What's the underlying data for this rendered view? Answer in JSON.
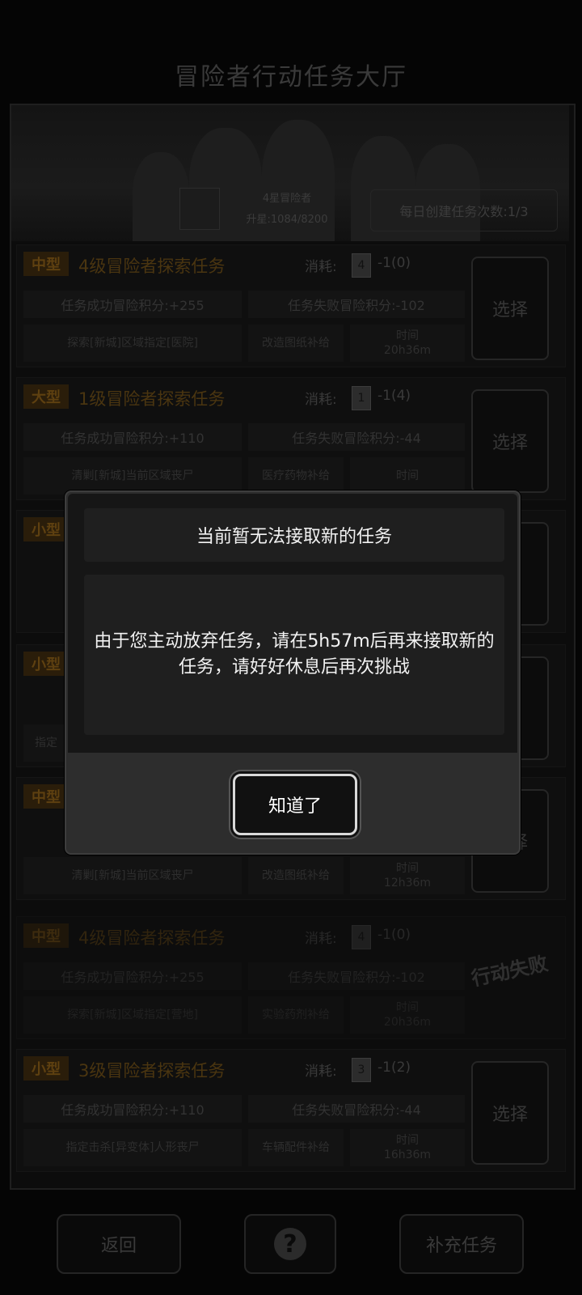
{
  "header": {
    "title": "冒险者行动任务大厅"
  },
  "profile": {
    "rank": "4星冒险者",
    "progress": "升星:1084/8200",
    "daily_tasks": "每日创建任务次数:1/3"
  },
  "tasks": [
    {
      "size": "中型",
      "title": "4级冒险者探索任务",
      "cost_label": "消耗:",
      "card_level": "4",
      "cost": "-1(0)",
      "success": "任务成功冒险积分:+255",
      "failure": "任务失败冒险积分:-102",
      "objective": "探索[新城]区域指定[医院]",
      "reward": "改造图纸补给",
      "time_label": "时间",
      "time": "20h36m",
      "action": "选择"
    },
    {
      "size": "大型",
      "title": "1级冒险者探索任务",
      "cost_label": "消耗:",
      "card_level": "1",
      "cost": "-1(4)",
      "success": "任务成功冒险积分:+110",
      "failure": "任务失败冒险积分:-44",
      "objective": "清剿[新城]当前区域丧尸",
      "reward": "医疗药物补给",
      "time_label": "时间",
      "time": "",
      "action": "选择"
    },
    {
      "size": "小型",
      "action": "择"
    },
    {
      "size": "小型",
      "objective": "指定",
      "action": "择"
    },
    {
      "size": "中型",
      "objective": "清剿[新城]当前区域丧尸",
      "reward": "改造图纸补给",
      "time_label": "时间",
      "time": "12h36m",
      "action": "选择"
    },
    {
      "size": "中型",
      "title": "4级冒险者探索任务",
      "cost_label": "消耗:",
      "card_level": "4",
      "cost": "-1(0)",
      "success": "任务成功冒险积分:+255",
      "failure": "任务失败冒险积分:-102",
      "objective": "探索[新城]区域指定[营地]",
      "reward": "实验药剂补给",
      "time_label": "时间",
      "time": "20h36m",
      "status": "行动失败"
    },
    {
      "size": "小型",
      "title": "3级冒险者探索任务",
      "cost_label": "消耗:",
      "card_level": "3",
      "cost": "-1(2)",
      "success": "任务成功冒险积分:+110",
      "failure": "任务失败冒险积分:-44",
      "objective": "指定击杀[异变体]人形丧尸",
      "reward": "车辆配件补给",
      "time_label": "时间",
      "time": "16h36m",
      "action": "选择"
    }
  ],
  "footer": {
    "back": "返回",
    "refill": "补充任务",
    "help_icon": "question-map-icon"
  },
  "dialog": {
    "title": "当前暂无法接取新的任务",
    "message": "由于您主动放弃任务，请在5h57m后再来接取新的任务，请好好休息后再次挑战",
    "ok": "知道了"
  }
}
